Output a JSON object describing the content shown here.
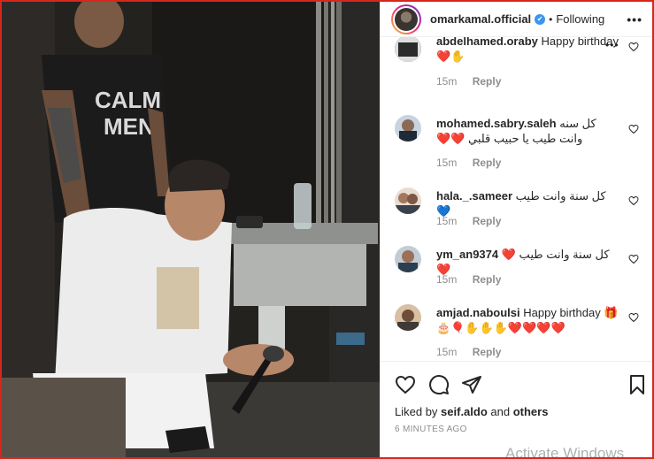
{
  "post": {
    "username": "omarkamal.official",
    "verified_mark": "✔",
    "dot": "•",
    "follow_status": "Following",
    "more_label": "•••"
  },
  "comments": [
    {
      "username": "abdelhamed.oraby",
      "text": "Happy birthday❤️✋",
      "time": "15m",
      "reply": "Reply",
      "more": "•••"
    },
    {
      "username": "mohamed.sabry.saleh",
      "text": "كل سنه وانت طيب يا حبيب قلبي ❤️❤️",
      "time": "15m",
      "reply": "Reply"
    },
    {
      "username": "hala._.sameer",
      "text": "كل سنة وانت طيب 💙",
      "time": "15m",
      "reply": "Reply"
    },
    {
      "username": "ym_an9374",
      "text": "كل سنة وانت طيب ❤️❤️",
      "time": "15m",
      "reply": "Reply"
    },
    {
      "username": "amjad.naboulsi",
      "text": "Happy birthday 🎁🎂🎈✋✋✋❤️❤️❤️❤️",
      "time": "15m",
      "reply": "Reply"
    }
  ],
  "actions": {
    "liked_prefix": "Liked by ",
    "liked_user": "seif.aldo",
    "liked_and": " and ",
    "liked_others": "others",
    "timestamp": "6 MINUTES AGO"
  },
  "watermark": "Activate Windows",
  "icons": {
    "heart": "heart-icon",
    "comment": "comment-icon",
    "share": "share-icon",
    "save": "bookmark-icon",
    "more": "more-icon"
  },
  "colors": {
    "frame": "#d9261c",
    "verified": "#3897f0",
    "muted": "#8e8e8e"
  }
}
